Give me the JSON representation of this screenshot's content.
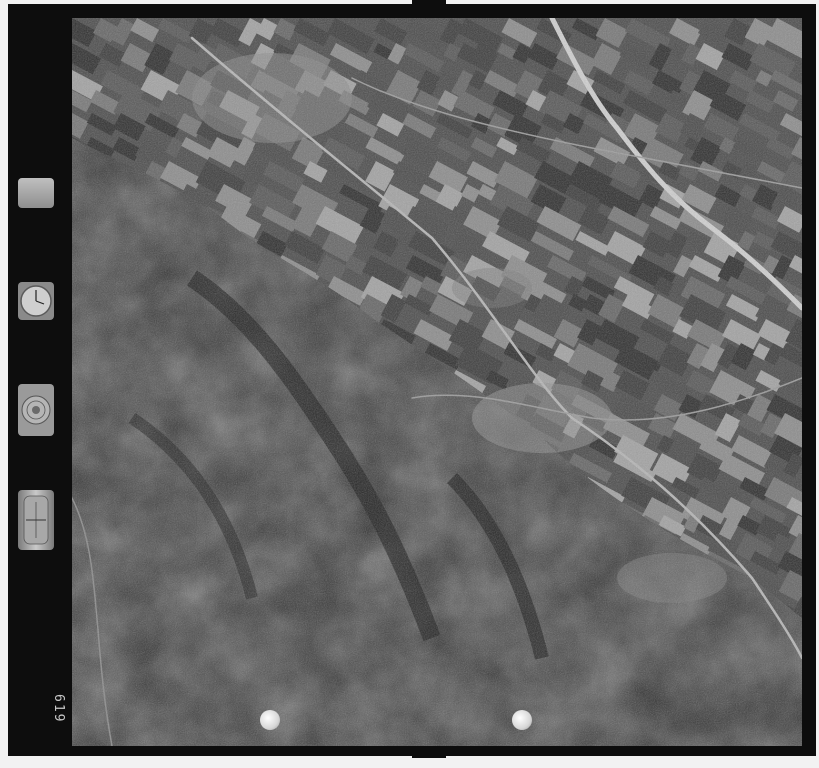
{
  "photo": {
    "frame_number": "619",
    "altimeter_label": "",
    "level_label": "",
    "tone_dark": "#2b2b2b",
    "tone_mid": "#5a5a5a",
    "tone_light": "#bdbdbd"
  }
}
